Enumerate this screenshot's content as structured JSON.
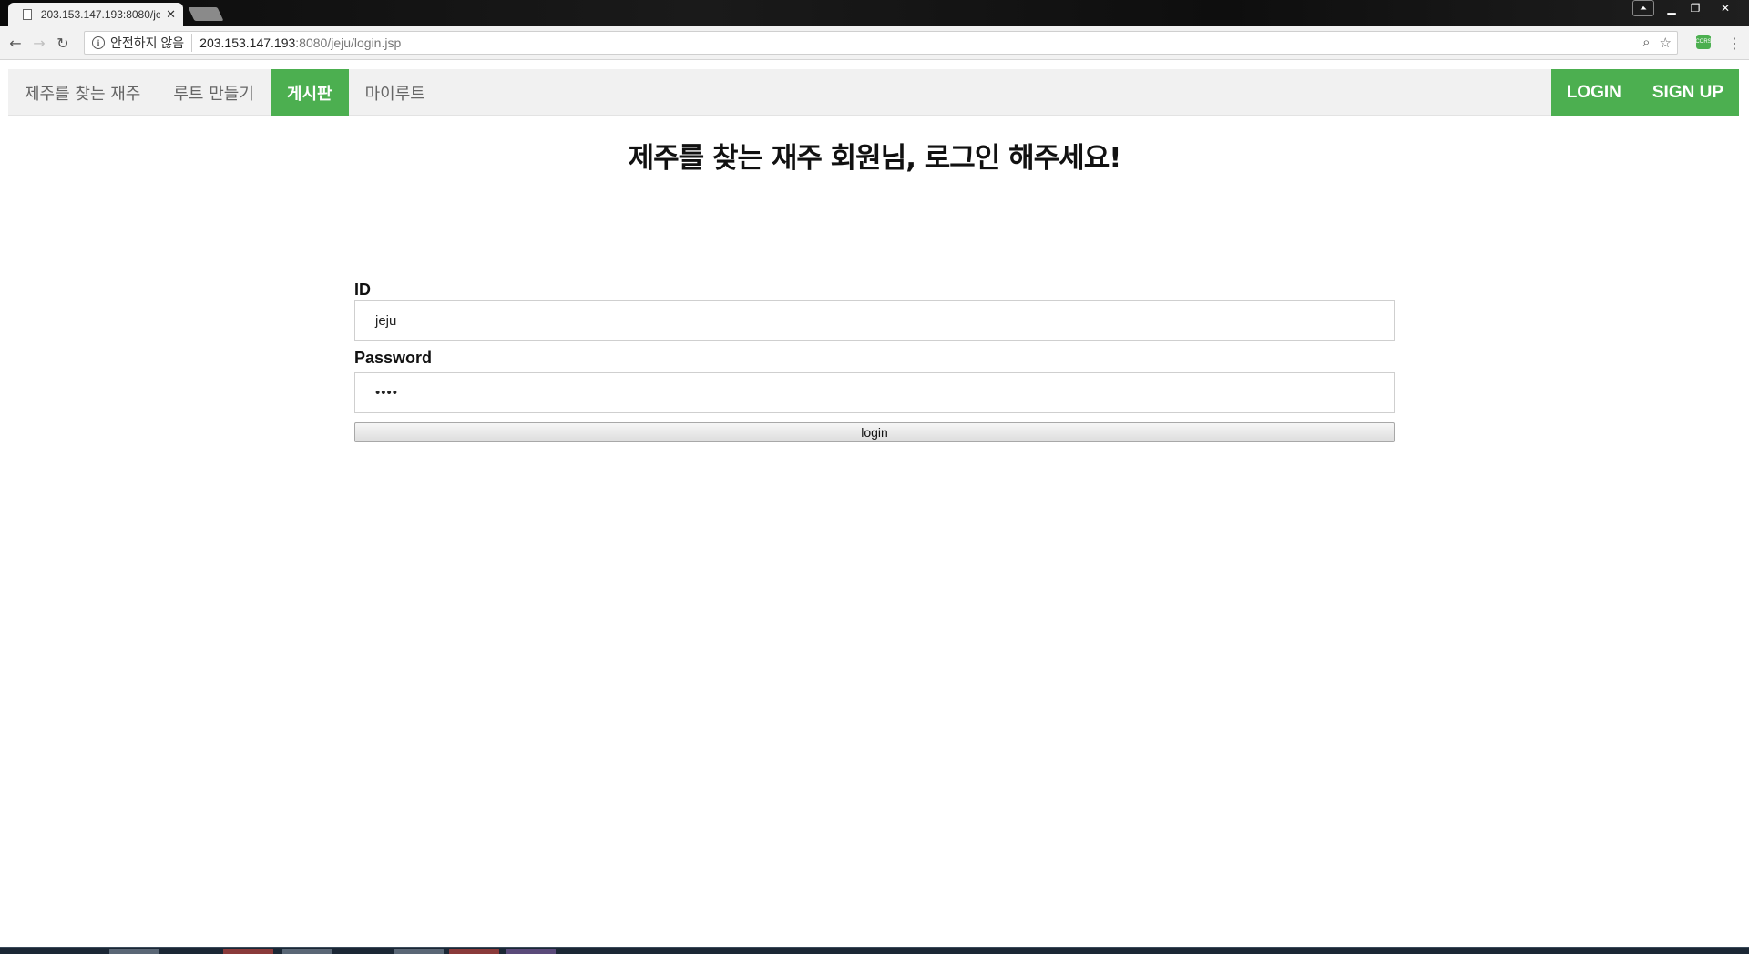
{
  "browser": {
    "tab_title": "203.153.147.193:8080/je",
    "tab_close": "✕",
    "security_label": "안전하지 않음",
    "url_host": "203.153.147.193",
    "url_path": ":8080/jeju/login.jsp",
    "extension_label": "CORS"
  },
  "nav": {
    "items": [
      {
        "label": "제주를 찾는 재주"
      },
      {
        "label": "루트 만들기"
      },
      {
        "label": "게시판"
      },
      {
        "label": "마이루트"
      }
    ],
    "right": [
      {
        "label": "LOGIN"
      },
      {
        "label": "SIGN UP"
      }
    ]
  },
  "main": {
    "heading": "제주를 찾는 재주 회원님, 로그인 해주세요!",
    "id_label": "ID",
    "id_value": "jeju",
    "password_label": "Password",
    "password_value": "••••",
    "login_button": "login"
  },
  "colors": {
    "accent": "#4caf50",
    "nav_bg": "#f1f1f1"
  }
}
